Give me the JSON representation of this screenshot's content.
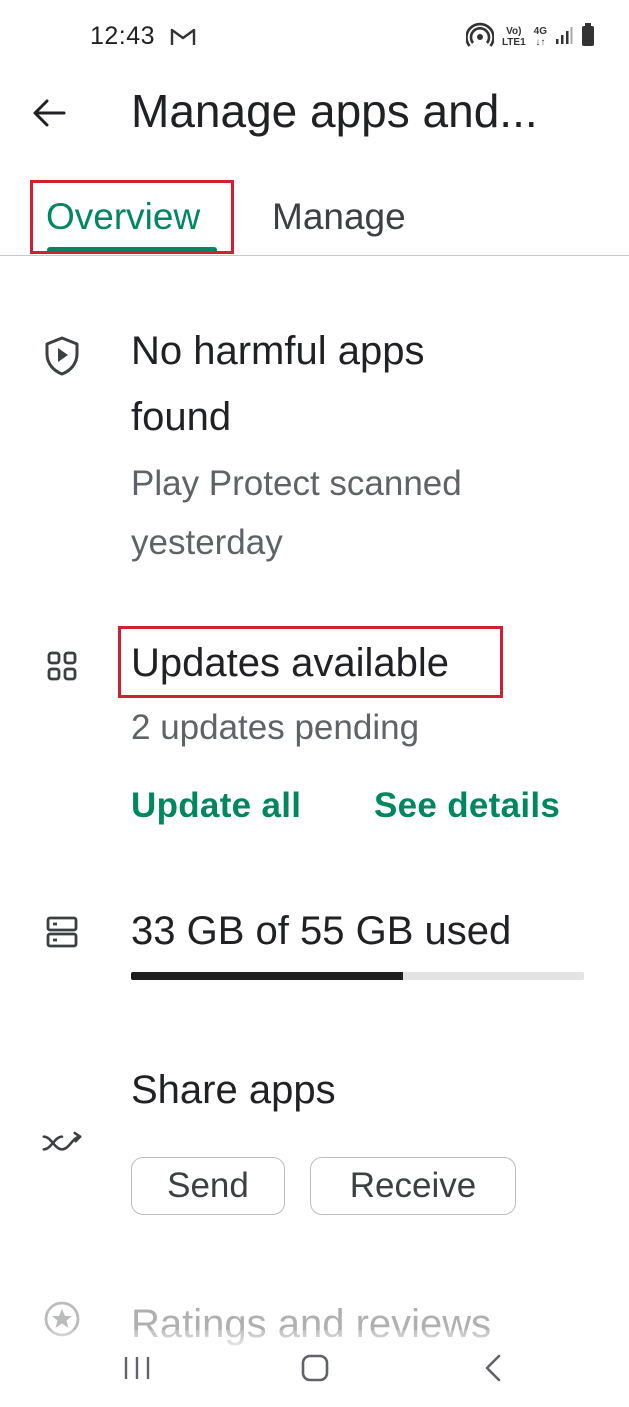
{
  "status_bar": {
    "time": "12:43",
    "volte_top": "Vo)",
    "volte_bottom": "LTE1",
    "network_top": "4G",
    "network_bottom": "↓↑"
  },
  "header": {
    "title": "Manage apps and..."
  },
  "tabs": [
    {
      "label": "Overview",
      "active": true
    },
    {
      "label": "Manage",
      "active": false
    }
  ],
  "protect": {
    "title_line1": "No harmful apps",
    "title_line2": "found",
    "subtitle_line1": "Play Protect scanned",
    "subtitle_line2": "yesterday"
  },
  "updates": {
    "title": "Updates available",
    "subtitle": "2 updates pending",
    "update_all": "Update all",
    "see_details": "See details"
  },
  "storage": {
    "label": "33 GB of 55 GB used",
    "used_fraction": 0.6
  },
  "share": {
    "title": "Share apps",
    "send": "Send",
    "receive": "Receive"
  },
  "ratings": {
    "title": "Ratings and reviews"
  },
  "colors": {
    "accent": "#01875f",
    "highlight": "#d32030"
  }
}
